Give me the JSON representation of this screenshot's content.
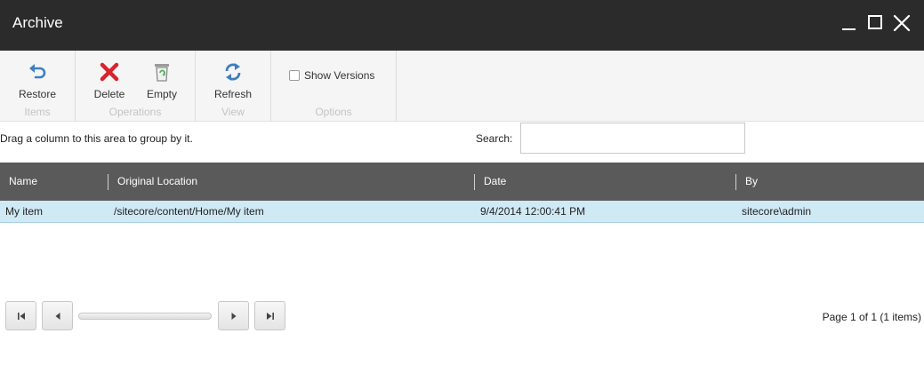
{
  "window": {
    "title": "Archive"
  },
  "ribbon": {
    "groups": [
      {
        "label": "Items",
        "buttons": [
          {
            "label": "Restore",
            "icon": "restore-arrow-icon"
          }
        ]
      },
      {
        "label": "Operations",
        "buttons": [
          {
            "label": "Delete",
            "icon": "red-x-icon"
          },
          {
            "label": "Empty",
            "icon": "recycle-bin-icon"
          }
        ]
      },
      {
        "label": "View",
        "buttons": [
          {
            "label": "Refresh",
            "icon": "refresh-icon"
          }
        ]
      },
      {
        "label": "Options",
        "checkbox": {
          "label": "Show Versions",
          "checked": false
        }
      }
    ]
  },
  "grouping": {
    "hint": "Drag a column to this area to group by it."
  },
  "search": {
    "label": "Search:",
    "value": "",
    "placeholder": ""
  },
  "grid": {
    "columns": [
      "Name",
      "Original Location",
      "Date",
      "By"
    ],
    "rows": [
      {
        "name": "My item",
        "location": "/sitecore/content/Home/My item",
        "date": "9/4/2014 12:00:41 PM",
        "by": "sitecore\\admin",
        "selected": true
      }
    ]
  },
  "pager": {
    "info": "Page 1 of 1 (1 items)"
  },
  "colors": {
    "titlebar": "#2b2b2b",
    "header": "#5a5a5a",
    "selected_row": "#cfe9f5",
    "icon_blue": "#3d7fc1",
    "icon_red": "#d9232d"
  }
}
